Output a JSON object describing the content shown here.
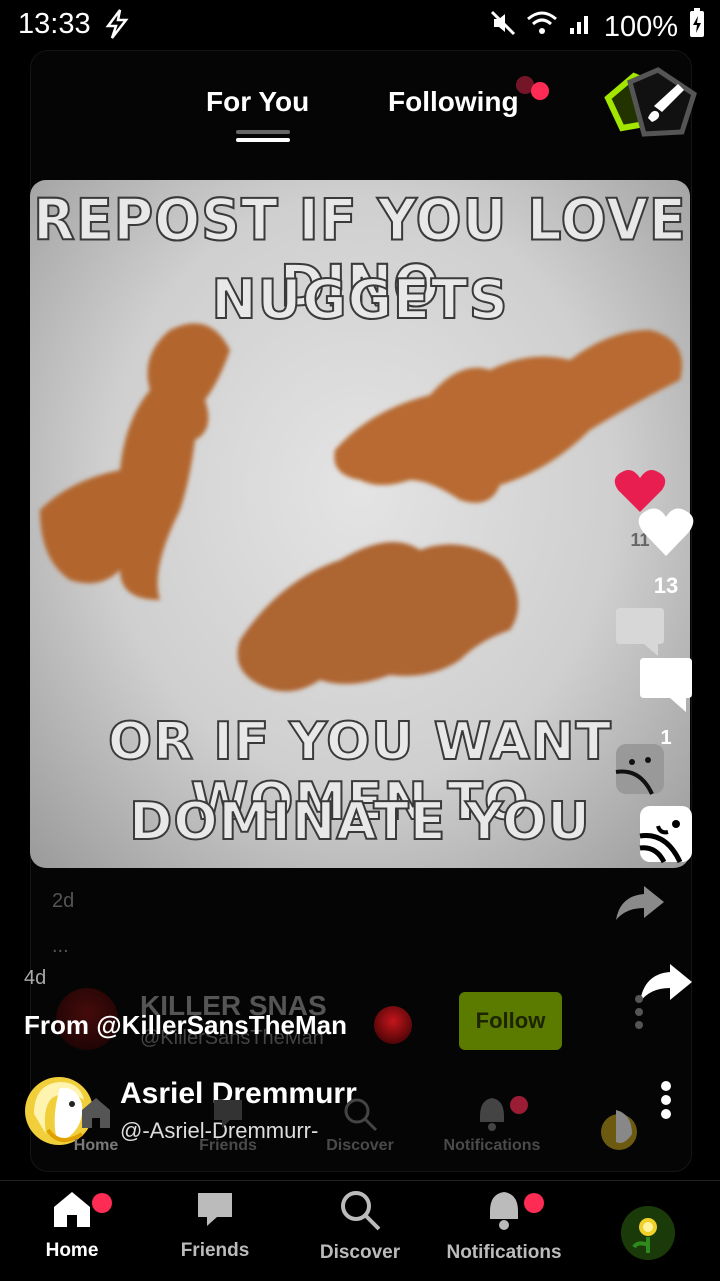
{
  "status": {
    "time": "13:33",
    "battery": "100%"
  },
  "tabs": {
    "for_you": "For You",
    "following": "Following"
  },
  "post": {
    "meme_line1": "REPOST IF YOU LOVE DINO",
    "meme_line2": "NUGGETS",
    "meme_line3": "OR IF YOU WANT WOMEN TO",
    "meme_line4": "DOMINATE YOU",
    "like_count": "13",
    "like_count_ghost": "11",
    "comment_count": "1",
    "age": "4d",
    "age_ghost": "2d",
    "ghost_more": "...",
    "from_text": "From @KillerSansTheMan",
    "ghost_author_name": "KILLER SNAS",
    "ghost_author_handle": "@KillerSansTheMan",
    "follow_label": "Follow",
    "reposter_name": "Asriel Dremmurr",
    "reposter_handle": "@-Asriel-Dremmurr-"
  },
  "nav": {
    "home": "Home",
    "friends": "Friends",
    "discover": "Discover",
    "notifications": "Notifications"
  },
  "colors": {
    "accent": "#fe2c55",
    "follow_bg": "#5b7a00",
    "lime": "#a3e600"
  }
}
